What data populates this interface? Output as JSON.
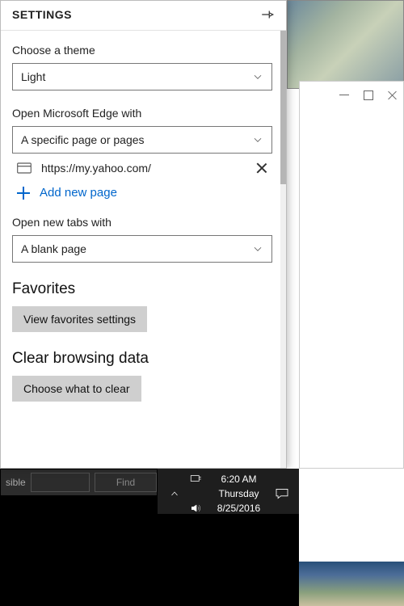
{
  "settings": {
    "title": "SETTINGS",
    "theme": {
      "label": "Choose a theme",
      "selected": "Light"
    },
    "open_with": {
      "label": "Open Microsoft Edge with",
      "selected": "A specific page or pages",
      "pages": [
        {
          "url": "https://my.yahoo.com/"
        }
      ],
      "add_label": "Add new page"
    },
    "new_tabs": {
      "label": "Open new tabs with",
      "selected": "A blank page"
    },
    "favorites": {
      "heading": "Favorites",
      "button": "View favorites settings"
    },
    "clear_data": {
      "heading": "Clear browsing data",
      "button": "Choose what to clear"
    }
  },
  "findbar": {
    "partial": "sible",
    "find_label": "Find"
  },
  "taskbar": {
    "time": "6:20 AM",
    "day": "Thursday",
    "date": "8/25/2016"
  }
}
